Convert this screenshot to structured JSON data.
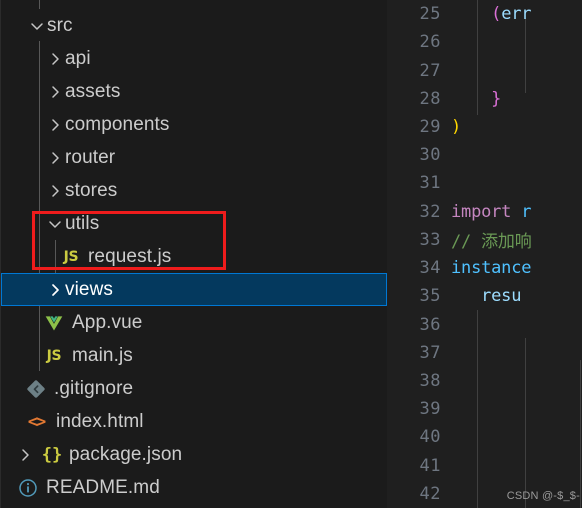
{
  "explorer": {
    "name": "file-explorer",
    "partial_top_item": {
      "label": "",
      "note": "clipped row above src"
    },
    "items": [
      {
        "label": "src",
        "kind": "folder",
        "expanded": true,
        "icon": "chevron-down-icon",
        "indent": 0,
        "selected": false
      },
      {
        "label": "api",
        "kind": "folder",
        "expanded": false,
        "icon": "chevron-right-icon",
        "indent": 1,
        "selected": false
      },
      {
        "label": "assets",
        "kind": "folder",
        "expanded": false,
        "icon": "chevron-right-icon",
        "indent": 1,
        "selected": false
      },
      {
        "label": "components",
        "kind": "folder",
        "expanded": false,
        "icon": "chevron-right-icon",
        "indent": 1,
        "selected": false
      },
      {
        "label": "router",
        "kind": "folder",
        "expanded": false,
        "icon": "chevron-right-icon",
        "indent": 1,
        "selected": false
      },
      {
        "label": "stores",
        "kind": "folder",
        "expanded": false,
        "icon": "chevron-right-icon",
        "indent": 1,
        "selected": false
      },
      {
        "label": "utils",
        "kind": "folder",
        "expanded": true,
        "icon": "chevron-down-icon",
        "indent": 1,
        "selected": false
      },
      {
        "label": "request.js",
        "kind": "file",
        "icon": "javascript-file-icon",
        "indent": 2,
        "selected": false
      },
      {
        "label": "views",
        "kind": "folder",
        "expanded": false,
        "icon": "chevron-right-icon",
        "indent": 1,
        "selected": true
      },
      {
        "label": "App.vue",
        "kind": "file",
        "icon": "vue-file-icon",
        "indent": 1,
        "selected": false
      },
      {
        "label": "main.js",
        "kind": "file",
        "icon": "javascript-file-icon",
        "indent": 1,
        "selected": false
      },
      {
        "label": ".gitignore",
        "kind": "file",
        "icon": "git-file-icon",
        "indent": 0,
        "selected": false
      },
      {
        "label": "index.html",
        "kind": "file",
        "icon": "html-file-icon",
        "indent": 0,
        "selected": false
      },
      {
        "label": "package.json",
        "kind": "file",
        "icon": "json-file-icon",
        "indent": 0,
        "selected": false,
        "has_chevron": true
      },
      {
        "label": "README.md",
        "kind": "file",
        "icon": "info-file-icon",
        "indent": 0,
        "selected": false
      }
    ],
    "annotation": {
      "shape": "rectangle",
      "color": "#ef1c1c",
      "covers": [
        "utils",
        "request.js"
      ]
    },
    "selection_color": "#04395e",
    "selection_border_color": "#0078d4"
  },
  "editor": {
    "name": "code-editor",
    "lines": [
      {
        "no": "25",
        "segments": [
          {
            "t": "    ",
            "c": "plain"
          },
          {
            "t": "(",
            "c": "tok-par"
          },
          {
            "t": "err",
            "c": "tok-fn"
          }
        ]
      },
      {
        "no": "26",
        "segments": []
      },
      {
        "no": "27",
        "segments": []
      },
      {
        "no": "28",
        "segments": [
          {
            "t": "    ",
            "c": "plain"
          },
          {
            "t": "}",
            "c": "tok-par"
          }
        ]
      },
      {
        "no": "29",
        "segments": [
          {
            "t": ")",
            "c": "tok-br"
          }
        ]
      },
      {
        "no": "30",
        "segments": []
      },
      {
        "no": "31",
        "segments": []
      },
      {
        "no": "32",
        "segments": [
          {
            "t": "import ",
            "c": "tok-kw"
          },
          {
            "t": "r",
            "c": "tok-var"
          }
        ]
      },
      {
        "no": "33",
        "segments": [
          {
            "t": "// 添加响",
            "c": "tok-cm"
          }
        ]
      },
      {
        "no": "34",
        "segments": [
          {
            "t": "instance",
            "c": "tok-id"
          }
        ]
      },
      {
        "no": "35",
        "segments": [
          {
            "t": "   ",
            "c": "plain"
          },
          {
            "t": "resu",
            "c": "tok-fn"
          }
        ]
      },
      {
        "no": "36",
        "segments": []
      },
      {
        "no": "37",
        "segments": []
      },
      {
        "no": "38",
        "segments": []
      },
      {
        "no": "39",
        "segments": []
      },
      {
        "no": "40",
        "segments": []
      },
      {
        "no": "41",
        "segments": []
      },
      {
        "no": "42",
        "segments": []
      }
    ]
  },
  "watermark": {
    "text": "CSDN @-$_$-"
  }
}
